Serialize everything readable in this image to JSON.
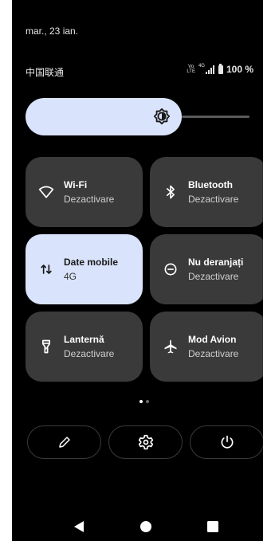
{
  "status": {
    "date": "mar., 23 ian.",
    "carrier": "中国联通",
    "volte_top": "Vo",
    "volte_bottom": "LTE",
    "network": "4G",
    "battery": "100 %"
  },
  "brightness": {
    "level": 0.7,
    "icon": "brightness-icon"
  },
  "tiles": [
    {
      "title": "Wi-Fi",
      "subtitle": "Dezactivare",
      "icon": "wifi-icon",
      "active": false
    },
    {
      "title": "Bluetooth",
      "subtitle": "Dezactivare",
      "icon": "bluetooth-icon",
      "active": false
    },
    {
      "title": "Date mobile",
      "subtitle": "4G",
      "icon": "mobile-data-icon",
      "active": true
    },
    {
      "title": "Nu deranjați",
      "subtitle": "Dezactivare",
      "icon": "do-not-disturb-icon",
      "active": false
    },
    {
      "title": "Lanternă",
      "subtitle": "Dezactivare",
      "icon": "flashlight-icon",
      "active": false
    },
    {
      "title": "Mod Avion",
      "subtitle": "Dezactivare",
      "icon": "airplane-icon",
      "active": false
    }
  ],
  "pager": {
    "current": 1,
    "total": 2
  },
  "actions": [
    {
      "icon": "edit-icon"
    },
    {
      "icon": "settings-icon"
    },
    {
      "icon": "power-icon"
    }
  ],
  "nav": {
    "back": "back-icon",
    "home": "home-icon",
    "recents": "recents-icon"
  },
  "colors": {
    "active_tile": "#d9e3fb",
    "inactive_tile": "#3a3a3a",
    "background": "#000000"
  }
}
